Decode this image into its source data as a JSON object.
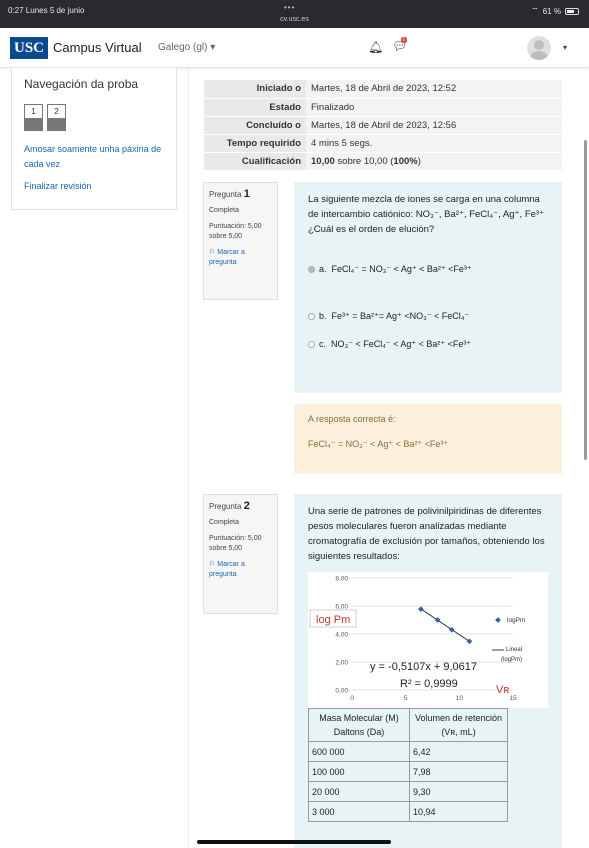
{
  "status_bar": {
    "time": "0:27  Lunes 5 de junio",
    "dots": "•••",
    "url": "cv.usc.es",
    "wifi": "⌔",
    "battery": "61 %"
  },
  "navbar": {
    "logo": "USC",
    "brand": "Campus Virtual",
    "language": "Galego (gl)",
    "chat_badge": "!",
    "brand_color": "#0b4a8e"
  },
  "quiz_nav": {
    "title": "Navegación da proba",
    "buttons": [
      "1",
      "2"
    ],
    "show_one_page": "Amosar soamente unha páxina de cada vez",
    "finish_review": "Finalizar revisión"
  },
  "summary": [
    {
      "label": "Iniciado o",
      "value": "Martes, 18 de Abril de 2023, 12:52"
    },
    {
      "label": "Estado",
      "value": "Finalizado"
    },
    {
      "label": "Concluído o",
      "value": "Martes, 18 de Abril de 2023, 12:56"
    },
    {
      "label": "Tempo requirido",
      "value": "4 mins 5 segs."
    },
    {
      "label": "Cualificación",
      "value_bold": "10,00",
      "value_mid": " sobre 10,00 (",
      "value_pct": "100%",
      "value_end": ")"
    }
  ],
  "q1": {
    "word": "Pregunta",
    "number": "1",
    "state": "Completa",
    "score": "Puntuación: 5,00 sobre 5,00",
    "flag": "Marcar a pregunta",
    "text": "La siguiente mezcla de iones se carga en una columna de intercambio catiónico: NO₃⁻, Ba²⁺, FeCl₄⁻, Ag⁺, Fe³⁺ ¿Cuál es el orden de elución?",
    "options": [
      {
        "letter": "a.",
        "text": "FeCl₄⁻ = NO₃⁻ < Ag⁺ < Ba²⁺ <Fe³⁺",
        "selected": true
      },
      {
        "letter": "b.",
        "text": "Fe³⁺ = Ba²⁺= Ag⁺ <NO₃⁻ < FeCl₄⁻",
        "selected": false
      },
      {
        "letter": "c.",
        "text": "NO₃⁻ < FeCl₄⁻ < Ag⁺ < Ba²⁺ <Fe³⁺",
        "selected": false
      }
    ],
    "correct_label": "A resposta correcta é:",
    "correct_answer": "FeCl₄⁻ = NO₃⁻ < Ag⁺ < Ba²⁺ <Fe³⁺"
  },
  "q2": {
    "word": "Pregunta",
    "number": "2",
    "state": "Completa",
    "score": "Puntuación: 5,00 sobre 5,00",
    "flag": "Marcar a pregunta",
    "text": "Una serie de patrones de polivinilpiridinas de diferentes pesos moleculares fueron analizadas mediante cromatografía de exclusión por tamaños, obteniendo los siguientes resultados:",
    "table_headers": [
      "Masa Molecular (M) Daltons (Da)",
      "Volumen de retención (Vʀ, mL)"
    ],
    "table_rows": [
      [
        "600 000",
        "6,42"
      ],
      [
        "100 000",
        "7,98"
      ],
      [
        "20 000",
        "9,30"
      ],
      [
        "3 000",
        "10,94"
      ]
    ]
  },
  "chart_data": {
    "type": "scatter",
    "y_ticks": [
      "8,00",
      "6,00",
      "4,00",
      "2,00",
      "0,00"
    ],
    "x_ticks": [
      "0",
      "5",
      "10",
      "15"
    ],
    "xlim": [
      0,
      15
    ],
    "ylim": [
      0,
      8
    ],
    "series": [
      {
        "name": "logPm",
        "x": [
          6.42,
          7.98,
          9.3,
          10.94
        ],
        "y": [
          5.78,
          5.0,
          4.3,
          3.48
        ]
      },
      {
        "name": "Lineal (logPm)",
        "slope": -0.5107,
        "intercept": 9.0617
      }
    ],
    "ylabel": "log Pm",
    "xlabel": "Vʀ",
    "equation": "y = -0,5107x + 9,0617",
    "r2": "R² = 0,9999",
    "grid": true,
    "legend_position": "right"
  }
}
